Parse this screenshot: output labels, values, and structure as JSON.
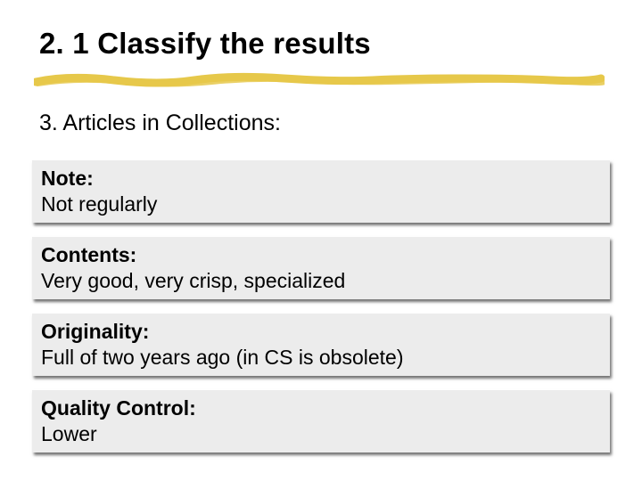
{
  "title": "2. 1 Classify the results",
  "subhead": "3.  Articles in Collections:",
  "blocks": [
    {
      "label": "Note:",
      "body": "Not regularly"
    },
    {
      "label": "Contents:",
      "body": "Very good, very crisp, specialized"
    },
    {
      "label": "Originality:",
      "body": "Full of two years ago (in CS is obsolete)"
    },
    {
      "label": "Quality Control:",
      "body": "Lower"
    }
  ],
  "colors": {
    "highlight": "#e6c84a"
  }
}
